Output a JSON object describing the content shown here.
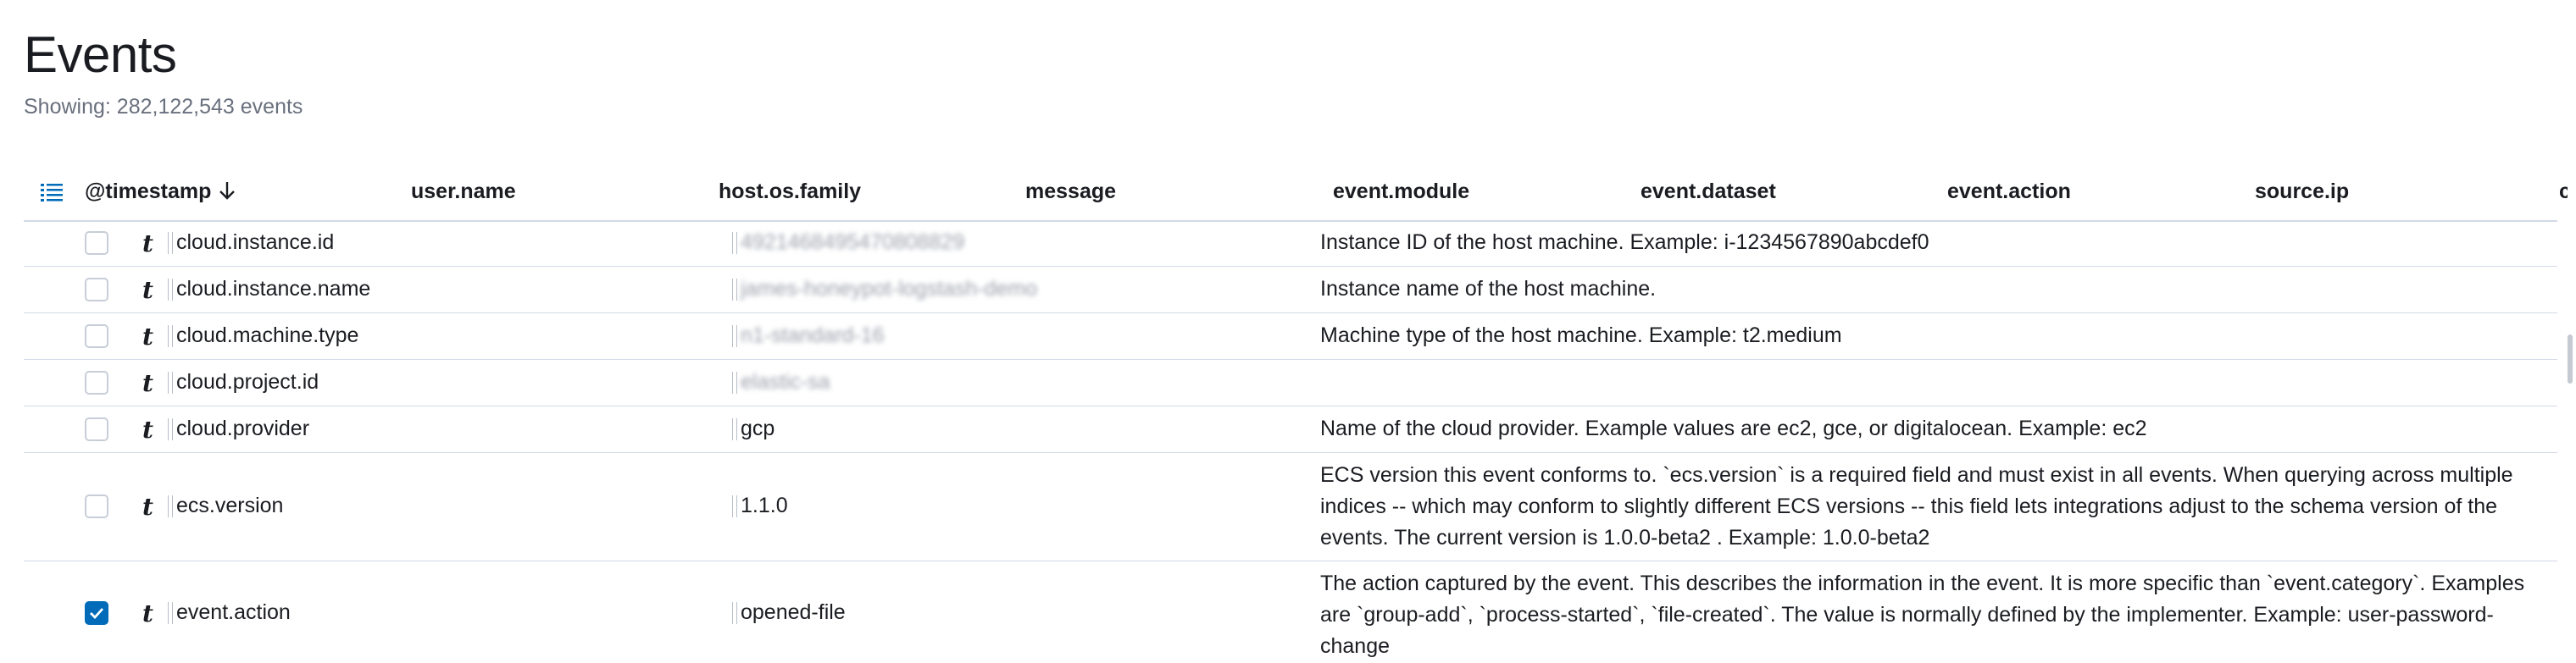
{
  "page": {
    "title": "Events",
    "subtitle": "Showing: 282,122,543 events"
  },
  "table": {
    "columns": [
      {
        "label": "@timestamp",
        "sorted": "desc"
      },
      {
        "label": "user.name"
      },
      {
        "label": "host.os.family"
      },
      {
        "label": "message"
      },
      {
        "label": "event.module"
      },
      {
        "label": "event.dataset"
      },
      {
        "label": "event.action"
      },
      {
        "label": "source.ip"
      },
      {
        "label": "c"
      }
    ]
  },
  "rows": [
    {
      "field": "cloud.instance.id",
      "type": "t",
      "value": "4921468495470808829",
      "value_blurred": true,
      "description": "Instance ID of the host machine. Example: i-1234567890abcdef0",
      "checked": false
    },
    {
      "field": "cloud.instance.name",
      "type": "t",
      "value": "james-honeypot-logstash-demo",
      "value_blurred": true,
      "description": "Instance name of the host machine.",
      "checked": false
    },
    {
      "field": "cloud.machine.type",
      "type": "t",
      "value": "n1-standard-16",
      "value_blurred": true,
      "description": "Machine type of the host machine. Example: t2.medium",
      "checked": false
    },
    {
      "field": "cloud.project.id",
      "type": "t",
      "value": "elastic-sa",
      "value_blurred": true,
      "description": "",
      "checked": false
    },
    {
      "field": "cloud.provider",
      "type": "t",
      "value": "gcp",
      "value_blurred": false,
      "description": "Name of the cloud provider. Example values are ec2, gce, or digitalocean. Example: ec2",
      "checked": false
    },
    {
      "field": "ecs.version",
      "type": "t",
      "value": "1.1.0",
      "value_blurred": false,
      "description": "ECS version this event conforms to. `ecs.version` is a required field and must exist in all events. When querying across multiple indices -- which may conform to slightly different ECS versions -- this field lets integrations adjust to the schema version of the events. The current version is 1.0.0-beta2 . Example: 1.0.0-beta2",
      "checked": false
    },
    {
      "field": "event.action",
      "type": "t",
      "value": "opened-file",
      "value_blurred": false,
      "description": "The action captured by the event. This describes the information in the event. It is more specific than `event.category`. Examples are `group-add`, `process-started`, `file-created`. The value is normally defined by the implementer. Example: user-password-change",
      "checked": true
    }
  ],
  "colors": {
    "accent": "#006bb8",
    "border": "#d3dae6",
    "text": "#1a1c21",
    "subdued": "#69707d"
  }
}
